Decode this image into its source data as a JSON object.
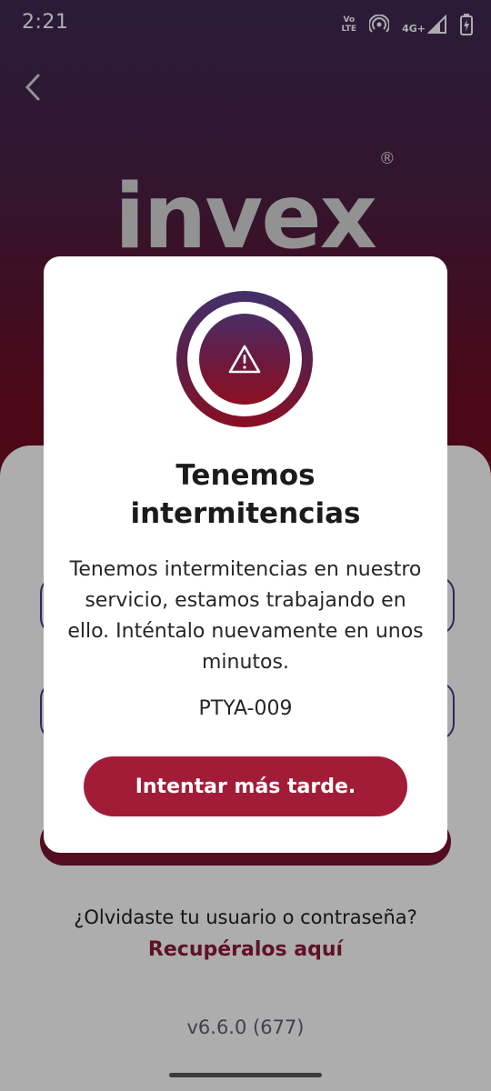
{
  "status_bar": {
    "time": "2:21",
    "volte_top": "Vo",
    "volte_bottom": "LTE",
    "network": "4G+",
    "icons": [
      "volte-icon",
      "hotspot-icon",
      "signal-icon",
      "battery-charging-icon"
    ]
  },
  "header": {
    "back_icon": "chevron-left-icon",
    "logo_text": "invex",
    "logo_registered": "®"
  },
  "login": {
    "forgot_text": "¿Olvidaste tu usuario o contraseña?",
    "recover_link": "Recupéralos aquí",
    "version": "v6.6.0 (677)"
  },
  "dialog": {
    "icon": "warning-triangle-icon",
    "title": "Tenemos intermitencias",
    "message": "Tenemos intermitencias en nuestro servicio, estamos trabajando en ello. Inténtalo nuevamente en unos minutos.",
    "code": "PTYA-009",
    "button_label": "Intentar más tarde."
  },
  "colors": {
    "brand_primary": "#a31c37",
    "brand_purple": "#44306a",
    "link": "#8e1b35"
  }
}
